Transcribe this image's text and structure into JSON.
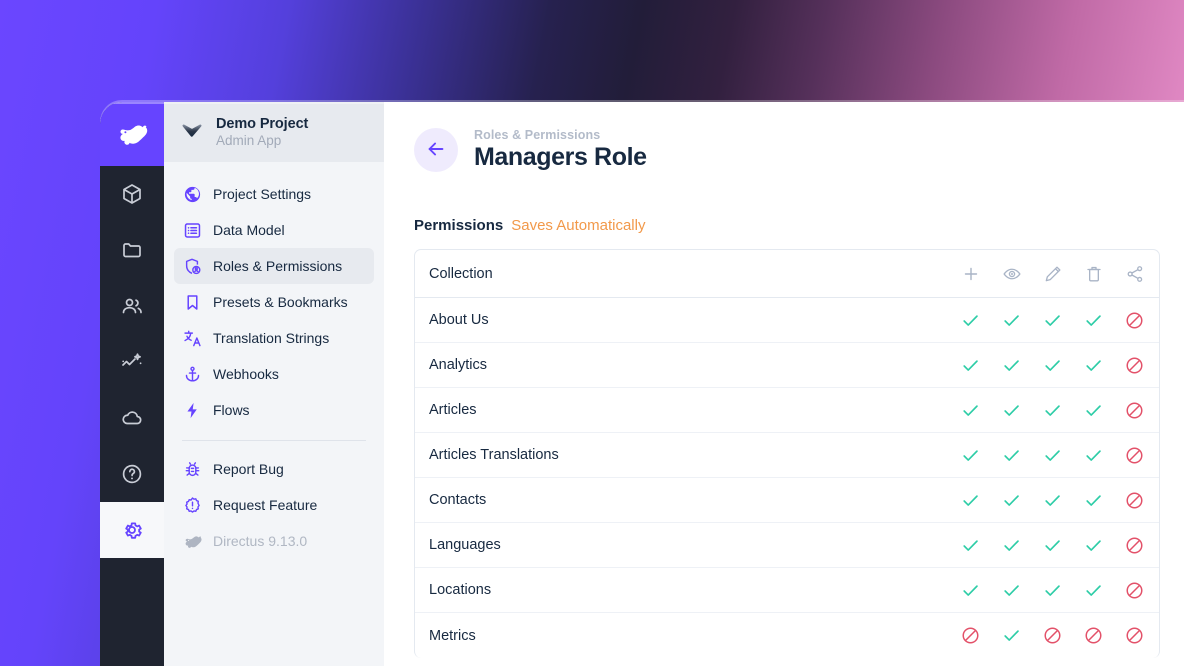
{
  "module_bar": {
    "logo": {
      "name": "directus-rabbit-logo",
      "accent": "#6644ff"
    },
    "items": [
      {
        "icon": "box-icon",
        "label": "Content",
        "active": false
      },
      {
        "icon": "folder-icon",
        "label": "File Library",
        "active": false
      },
      {
        "icon": "users-icon",
        "label": "User Directory",
        "active": false
      },
      {
        "icon": "insights-icon",
        "label": "Insights",
        "active": false
      },
      {
        "icon": "cloud-icon",
        "label": "Directus Cloud",
        "active": false
      },
      {
        "icon": "help-icon",
        "label": "Help & Docs",
        "active": false
      },
      {
        "icon": "gear-icon",
        "label": "Settings",
        "active": true
      }
    ]
  },
  "sidebar": {
    "project": {
      "name": "Demo Project",
      "subtitle": "Admin App",
      "icon": "directus-logo-dark"
    },
    "items": [
      {
        "label": "Project Settings",
        "icon": "globe-icon",
        "active": false
      },
      {
        "label": "Data Model",
        "icon": "list-alt-icon",
        "active": false
      },
      {
        "label": "Roles & Permissions",
        "icon": "admin-panel-settings-icon",
        "active": true
      },
      {
        "label": "Presets & Bookmarks",
        "icon": "bookmark-icon",
        "active": false
      },
      {
        "label": "Translation Strings",
        "icon": "translate-icon",
        "active": false
      },
      {
        "label": "Webhooks",
        "icon": "anchor-icon",
        "active": false
      },
      {
        "label": "Flows",
        "icon": "bolt-icon",
        "active": false
      }
    ],
    "footer_items": [
      {
        "label": "Report Bug",
        "icon": "bug-report-icon",
        "muted": false
      },
      {
        "label": "Request Feature",
        "icon": "feature-request-icon",
        "muted": false
      },
      {
        "label": "Directus 9.13.0",
        "icon": "directus-rabbit-icon",
        "muted": true
      }
    ]
  },
  "header": {
    "breadcrumb": "Roles & Permissions",
    "title": "Managers Role",
    "back_icon": "arrow-left-icon"
  },
  "permissions": {
    "label": "Permissions",
    "note": "Saves Automatically",
    "note_color": "#f2994a",
    "allow_color": "#2ecda7",
    "deny_color": "#e35169",
    "columns": [
      {
        "key": "collection",
        "label": "Collection",
        "icon": null
      },
      {
        "key": "create",
        "label": "Create",
        "icon": "plus-icon"
      },
      {
        "key": "read",
        "label": "Read",
        "icon": "eye-icon"
      },
      {
        "key": "update",
        "label": "Update",
        "icon": "pencil-icon"
      },
      {
        "key": "delete",
        "label": "Delete",
        "icon": "trash-icon"
      },
      {
        "key": "share",
        "label": "Share",
        "icon": "share-icon"
      }
    ],
    "rows": [
      {
        "collection": "About Us",
        "values": [
          "allow",
          "allow",
          "allow",
          "allow",
          "deny"
        ]
      },
      {
        "collection": "Analytics",
        "values": [
          "allow",
          "allow",
          "allow",
          "allow",
          "deny"
        ]
      },
      {
        "collection": "Articles",
        "values": [
          "allow",
          "allow",
          "allow",
          "allow",
          "deny"
        ]
      },
      {
        "collection": "Articles Translations",
        "values": [
          "allow",
          "allow",
          "allow",
          "allow",
          "deny"
        ]
      },
      {
        "collection": "Contacts",
        "values": [
          "allow",
          "allow",
          "allow",
          "allow",
          "deny"
        ]
      },
      {
        "collection": "Languages",
        "values": [
          "allow",
          "allow",
          "allow",
          "allow",
          "deny"
        ]
      },
      {
        "collection": "Locations",
        "values": [
          "allow",
          "allow",
          "allow",
          "allow",
          "deny"
        ]
      },
      {
        "collection": "Metrics",
        "values": [
          "deny",
          "allow",
          "deny",
          "deny",
          "deny"
        ]
      }
    ]
  }
}
